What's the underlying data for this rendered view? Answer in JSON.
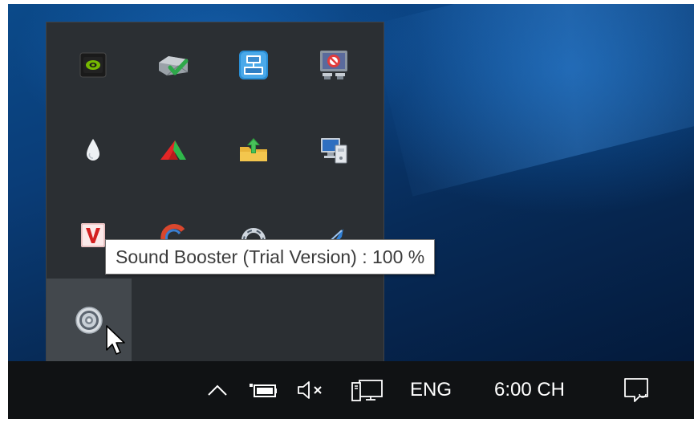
{
  "tooltip": {
    "text": "Sound Booster (Trial Version) : 100 %"
  },
  "overflow_icons": [
    {
      "name": "nvidia-icon"
    },
    {
      "name": "printer-check-icon"
    },
    {
      "name": "network-config-icon"
    },
    {
      "name": "display-blocked-icon"
    },
    {
      "name": "water-drop-icon"
    },
    {
      "name": "red-green-arrow-icon"
    },
    {
      "name": "upload-folder-icon"
    },
    {
      "name": "computer-device-icon"
    },
    {
      "name": "v-logo-icon"
    },
    {
      "name": "sound-booster-icon",
      "active": true
    }
  ],
  "taskbar": {
    "language": "ENG",
    "clock": "6:00 CH",
    "icons": [
      "chevron-up-icon",
      "battery-icon",
      "speaker-muted-icon",
      "network-icon",
      "notification-icon"
    ]
  },
  "colors": {
    "panel_bg": "#2b2f33",
    "taskbar_bg": "#101214",
    "active_icon_bg": "#43484d"
  }
}
